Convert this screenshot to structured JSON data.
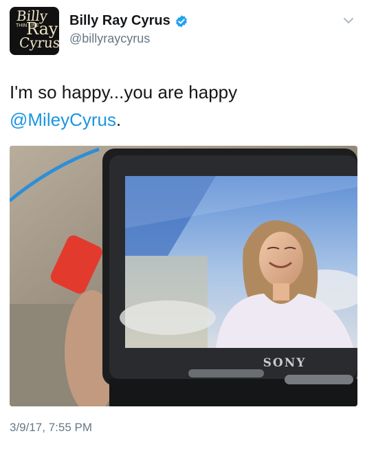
{
  "author": {
    "name": "Billy Ray Cyrus",
    "handle": "@billyraycyrus",
    "verified": true,
    "avatar_text": [
      "Billy",
      "THIN LINE",
      "Ray",
      "Cyrus"
    ]
  },
  "tweet": {
    "text_before": "I'm so happy...you are happy",
    "mention": "@MileyCyrus",
    "text_after": "."
  },
  "photo": {
    "camera_brand": "SONY"
  },
  "timestamp": "3/9/17, 7:55 PM",
  "icons": {
    "verified": "verified-badge-icon",
    "menu": "chevron-down-icon"
  },
  "colors": {
    "link": "#1b95e0",
    "secondary_text": "#657786",
    "verified": "#1da1f2"
  }
}
